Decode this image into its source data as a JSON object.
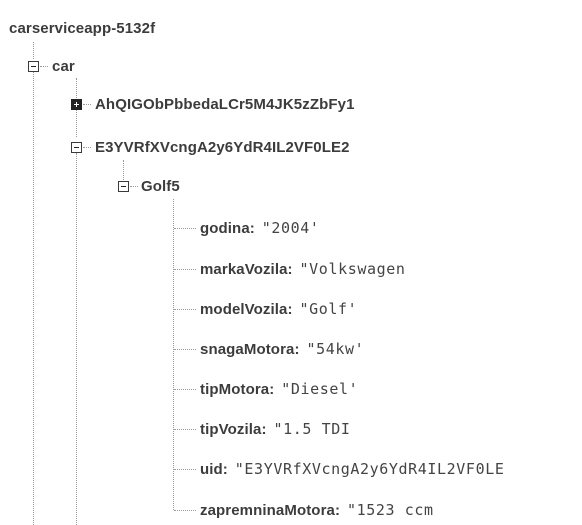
{
  "root": {
    "label": "carserviceapp-5132f"
  },
  "car": {
    "label": "car",
    "children": [
      {
        "id": "AhQIGObPbbedaLCr5M4JK5zZbFy1",
        "expanded": false
      },
      {
        "id": "E3YVRfXVcngA2y6YdR4IL2VF0LE2",
        "expanded": true,
        "vehicle": {
          "label": "Golf5",
          "fields": [
            {
              "key": "godina",
              "value": "\"2004'"
            },
            {
              "key": "markaVozila",
              "value": "\"Volkswagen"
            },
            {
              "key": "modelVozila",
              "value": "\"Golf'"
            },
            {
              "key": "snagaMotora",
              "value": "\"54kw'"
            },
            {
              "key": "tipMotora",
              "value": "\"Diesel'"
            },
            {
              "key": "tipVozila",
              "value": "\"1.5 TDI"
            },
            {
              "key": "uid",
              "value": "\"E3YVRfXVcngA2y6YdR4IL2VF0LE"
            },
            {
              "key": "zapremninaMotora",
              "value": "\"1523 ccm"
            }
          ]
        }
      }
    ]
  },
  "icons": {
    "expanded": "minus-box-icon",
    "collapsed": "plus-box-icon"
  }
}
